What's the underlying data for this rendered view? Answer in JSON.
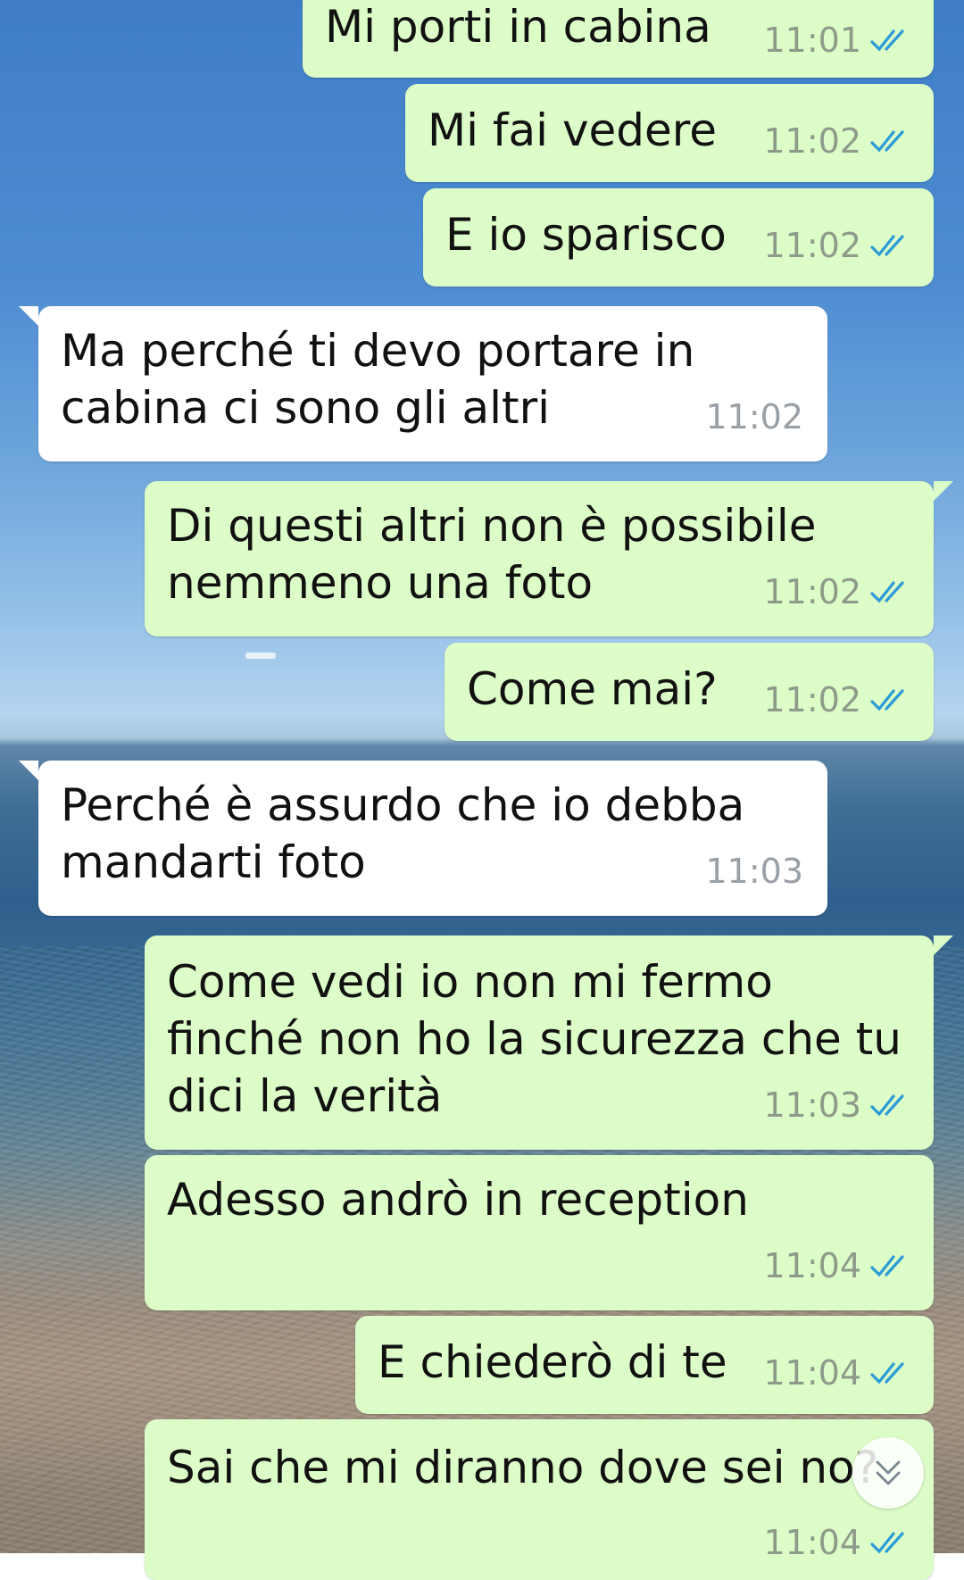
{
  "messages": [
    {
      "text": "Mi porti in cabina",
      "time": "11:01",
      "direction": "outgoing",
      "read": true
    },
    {
      "text": "Mi fai vedere",
      "time": "11:02",
      "direction": "outgoing",
      "read": true
    },
    {
      "text": "E io sparisco",
      "time": "11:02",
      "direction": "outgoing",
      "read": true
    },
    {
      "text": "Ma perché ti devo portare in\ncabina ci sono gli altri",
      "time": "11:02",
      "direction": "incoming"
    },
    {
      "text": "Di questi altri non è possibile\nnemmeno una foto",
      "time": "11:02",
      "direction": "outgoing",
      "read": true
    },
    {
      "text": "Come mai?",
      "time": "11:02",
      "direction": "outgoing",
      "read": true
    },
    {
      "text": "Perché è assurdo che io debba\nmandarti foto",
      "time": "11:03",
      "direction": "incoming"
    },
    {
      "text": "Come vedi io non mi fermo\nfinché non ho la sicurezza che tu\ndici la verità",
      "time": "11:03",
      "direction": "outgoing",
      "read": true
    },
    {
      "text": "Adesso andrò in reception",
      "time": "11:04",
      "direction": "outgoing",
      "read": true
    },
    {
      "text": "E chiederò di te",
      "time": "11:04",
      "direction": "outgoing",
      "read": true
    },
    {
      "text": "Sai che mi diranno dove sei no?",
      "time": "11:04",
      "direction": "outgoing",
      "read": true
    }
  ],
  "colors": {
    "outgoing_bubble": "#dcfdc8",
    "incoming_bubble": "#ffffff",
    "read_ticks": "#2a9bd6"
  },
  "icons": {
    "read_receipt": "double-check-icon",
    "scroll_down": "chevron-double-down-icon"
  }
}
